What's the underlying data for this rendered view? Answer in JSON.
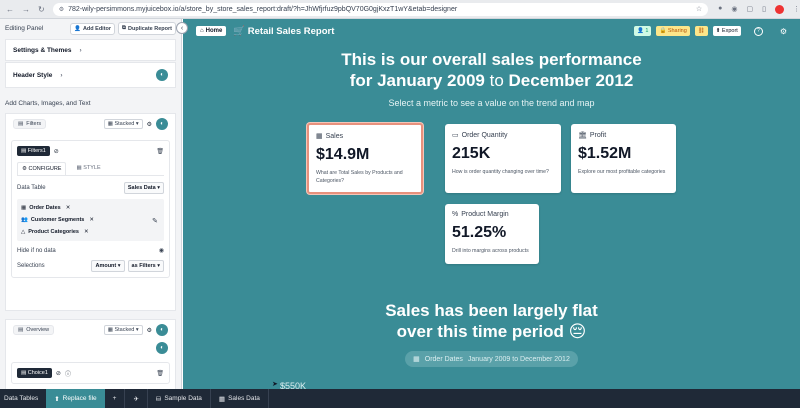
{
  "browser": {
    "url": "782-wily-persimmons.myjuicebox.io/a/store_by_store_sales_report:draft/?h=JhWfjrfuz9pbQV70G0gjKxzT1wY&etab=designer",
    "nav_icons": [
      "arrow-left-icon",
      "arrow-right-icon",
      "reload-icon"
    ]
  },
  "sidebar": {
    "title": "Editing Panel",
    "add_editor": "Add Editor",
    "duplicate_report": "Duplicate Report",
    "settings": "Settings & Themes",
    "header_style": "Header Style",
    "add_label": "Add Charts, Images, and Text",
    "filters_panel": {
      "name": "Filters",
      "layout": "Stacked",
      "chip": "Filters1",
      "tab_configure": "CONFIGURE",
      "tab_style": "STYLE",
      "data_table_label": "Data Table",
      "data_table_value": "Sales Data",
      "filters": [
        "Order Dates",
        "Customer Segments",
        "Product Categories"
      ],
      "hide_label": "Hide if no data",
      "selections_label": "Selections",
      "selection_measure": "Amount",
      "selection_mode": "as Filters"
    },
    "overview_panel": {
      "name": "Overview",
      "layout": "Stacked",
      "chip": "Choice1"
    }
  },
  "report": {
    "home": "Home",
    "title": "Retail Sales Report",
    "title_icon": "shopping-cart-icon",
    "viewers": "1",
    "sharing": "Sharing",
    "export": "Export",
    "headline_1": "This is our overall sales performance",
    "headline_2_pre": "for January 2009",
    "headline_2_to": "to",
    "headline_2_post": "December 2012",
    "subtitle": "Select a metric to see a value on the trend and map",
    "cards": [
      {
        "label": "Sales",
        "value": "$14.9M",
        "desc": "What are Total Sales by Products and Categories?",
        "selected": true,
        "icon": "table-icon"
      },
      {
        "label": "Order Quantity",
        "value": "215K",
        "desc": "How is order quantity changing over time?",
        "selected": false,
        "icon": "ruler-icon"
      },
      {
        "label": "Profit",
        "value": "$1.52M",
        "desc": "Explore our most profitable categories",
        "selected": false,
        "icon": "building-icon"
      },
      {
        "label": "Product Margin",
        "value": "51.25%",
        "desc": "Drill into margins across products",
        "selected": false,
        "icon": "percent-icon"
      }
    ],
    "section2_line1": "Sales has been largely flat",
    "section2_line2": "over this time period 😔",
    "date_filter_label": "Order Dates",
    "date_filter_value": "January 2009 to December 2012",
    "axis_fragment": "$550K"
  },
  "bottom_bar": {
    "data_tables": "Data Tables",
    "replace_file": "Replace file",
    "sample_data": "Sample Data",
    "sales_data": "Sales Data"
  },
  "colors": {
    "report_bg": "#3a8c96",
    "selected_card_border": "#e8917d"
  }
}
